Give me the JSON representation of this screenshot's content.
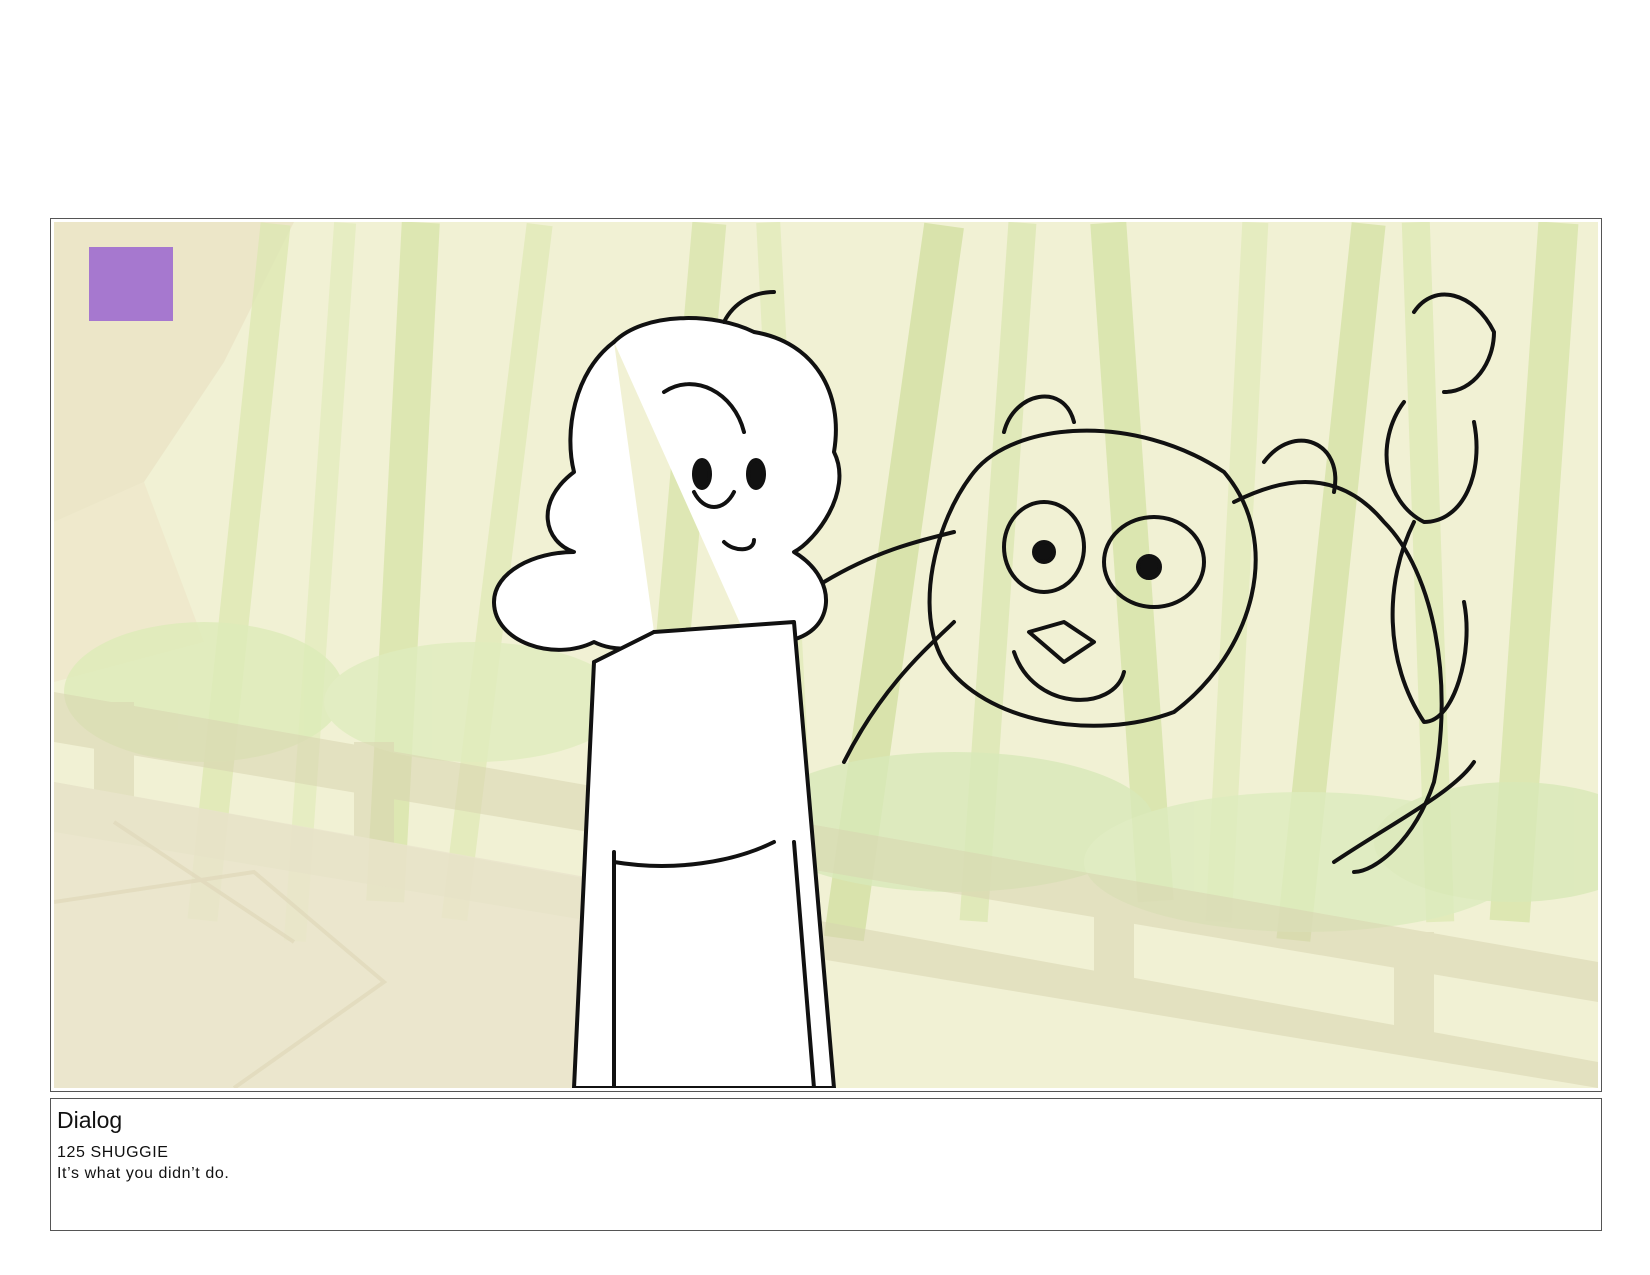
{
  "panel": {
    "marker_color": "#a678cf",
    "illustration": "storyboard-sketch"
  },
  "dialog": {
    "heading": "Dialog",
    "speaker_line": "125 SHUGGIE",
    "line": "It’s what you didn’t do."
  },
  "colors": {
    "bamboo_light": "#dbe8a8",
    "bamboo_dark": "#b9d47c",
    "stone": "#e6dfc0",
    "foliage": "#cfe6a6"
  }
}
